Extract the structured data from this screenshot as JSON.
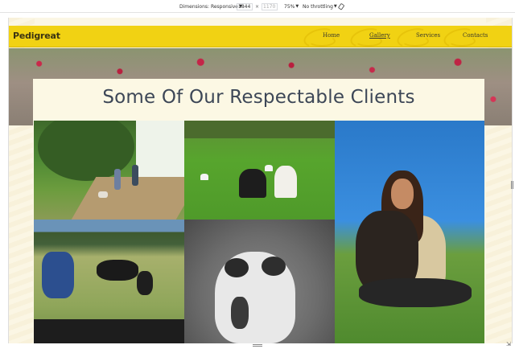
{
  "devtools": {
    "dimensions_label": "Dimensions: Responsive",
    "width_value": "1844",
    "height_placeholder": "1170",
    "zoom_label": "75%",
    "throttle_label": "No throttling",
    "rotate_icon": "rotate-icon"
  },
  "site": {
    "brand": "Pedigreat",
    "nav": [
      {
        "label": "Home",
        "active": false
      },
      {
        "label": "Gallery",
        "active": true
      },
      {
        "label": "Services",
        "active": false
      },
      {
        "label": "Contacts",
        "active": false
      }
    ],
    "accent_color": "#f1d213",
    "heading_color": "#3d4757"
  },
  "gallery": {
    "title": "Some Of Our Respectable Clients",
    "photos": [
      "family-walking-dogs-photo",
      "women-on-lawn-photo",
      "woman-hugging-dog-photo",
      "boy-with-dogs-photo",
      "puppy-portrait-photo"
    ]
  }
}
